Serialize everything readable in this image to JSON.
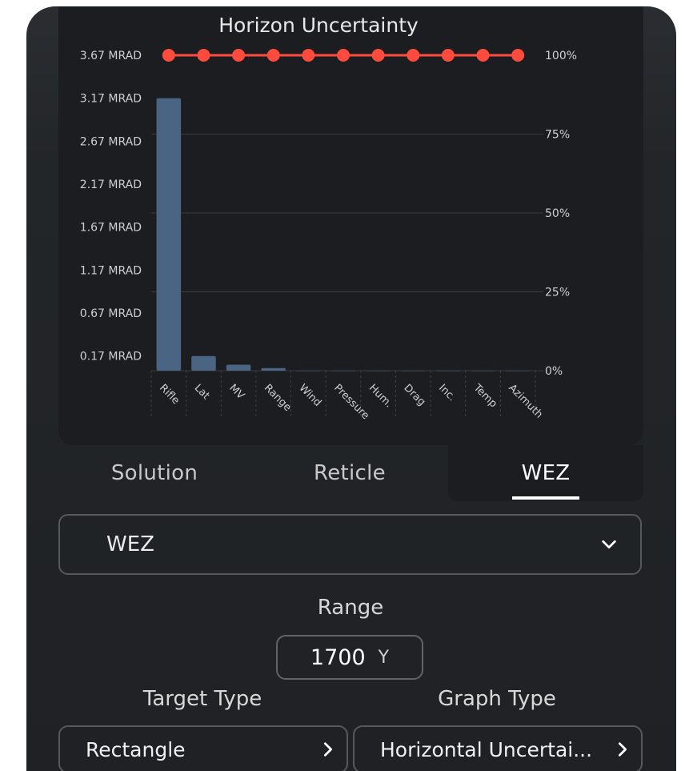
{
  "chart_data": {
    "type": "bar",
    "title": "Horizon Uncertainty",
    "categories": [
      "Rifle",
      "Lat",
      "MV",
      "Range",
      "Wind",
      "Pressure",
      "Hum.",
      "Drag",
      "Inc.",
      "Temp",
      "Azimuth"
    ],
    "series": [
      {
        "values": [
          3.17,
          0.17,
          0.07,
          0.03,
          0.0,
          0.0,
          0.0,
          0.0,
          0.0,
          0.0,
          0.0
        ],
        "axis": "left",
        "style": "bar"
      },
      {
        "values": [
          100,
          100,
          100,
          100,
          100,
          100,
          100,
          100,
          100,
          100,
          100
        ],
        "axis": "right",
        "style": "line"
      }
    ],
    "yticks_left": [
      "3.67 MRAD",
      "3.17 MRAD",
      "2.67 MRAD",
      "2.17 MRAD",
      "1.67 MRAD",
      "1.17 MRAD",
      "0.67 MRAD",
      "0.17 MRAD"
    ],
    "yticks_right": [
      "100%",
      "75%",
      "50%",
      "25%",
      "0%"
    ],
    "ylim_left": [
      0,
      3.67
    ],
    "ylim_right": [
      0,
      100
    ],
    "colors": {
      "bar": "#4a6483",
      "line": "#ff4b3e",
      "grid": "#3a3c40"
    }
  },
  "tabs": [
    {
      "label": "Solution"
    },
    {
      "label": "Reticle"
    },
    {
      "label": "WEZ"
    }
  ],
  "dropdown": {
    "value": "WEZ",
    "icon": "chevron-down-icon"
  },
  "range": {
    "label": "Range",
    "value": "1700",
    "unit": "Y"
  },
  "target_type": {
    "label": "Target Type",
    "value": "Rectangle"
  },
  "graph_type": {
    "label": "Graph Type",
    "value": "Horizontal Uncertai..."
  }
}
